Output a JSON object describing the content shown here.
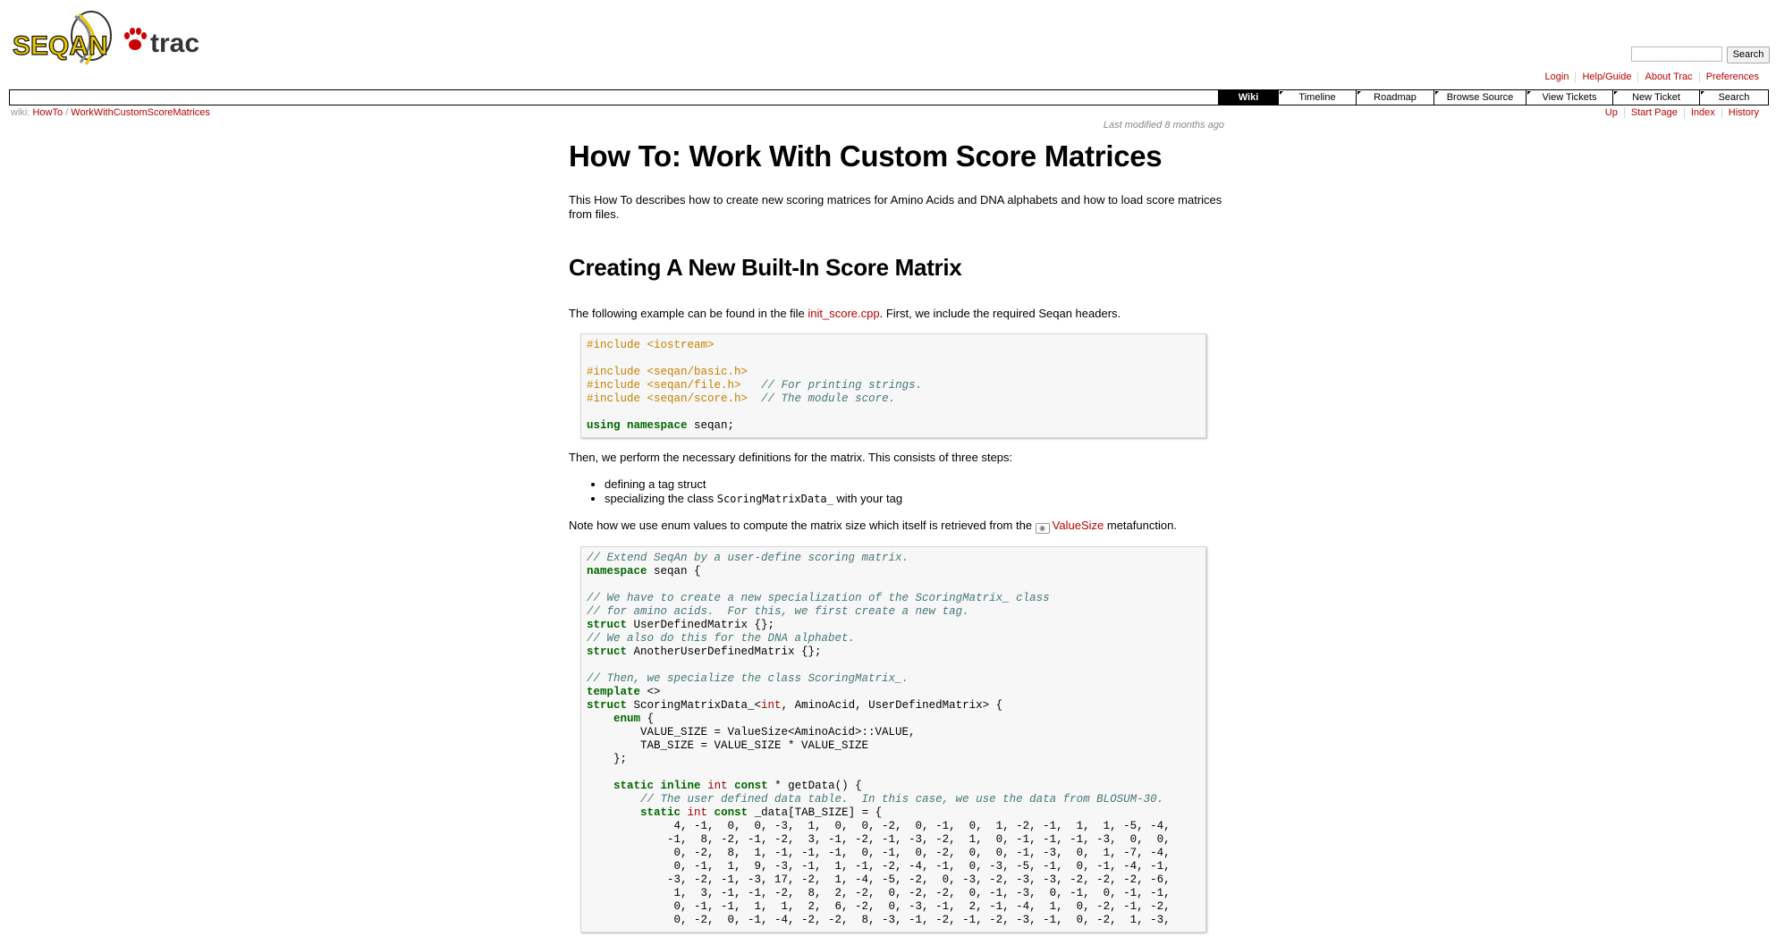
{
  "header": {
    "logo_text": "SEQAN",
    "logo_suffix": "trac",
    "search_button": "Search",
    "metanav": [
      "Login",
      "Help/Guide",
      "About Trac",
      "Preferences"
    ]
  },
  "mainnav": [
    {
      "label": "Wiki",
      "active": true
    },
    {
      "label": "Timeline",
      "active": false
    },
    {
      "label": "Roadmap",
      "active": false
    },
    {
      "label": "Browse Source",
      "active": false
    },
    {
      "label": "View Tickets",
      "active": false
    },
    {
      "label": "New Ticket",
      "active": false
    },
    {
      "label": "Search",
      "active": false
    }
  ],
  "breadcrumb": {
    "prefix": "wiki:",
    "items": [
      "HowTo",
      "WorkWithCustomScoreMatrices"
    ],
    "separator": "/"
  },
  "ctxtnav": [
    "Up",
    "Start Page",
    "Index",
    "History"
  ],
  "page": {
    "last_modified": "Last modified 8 months ago",
    "title": "How To: Work With Custom Score Matrices",
    "intro": "This How To describes how to create new scoring matrices for Amino Acids and DNA alphabets and how to load score matrices from files.",
    "section1_title": "Creating A New Built-In Score Matrix",
    "example_pre": "The following example can be found in the file ",
    "example_link": "init_score.cpp",
    "example_post": ". First, we include the required Seqan headers.",
    "defs_text": "Then, we perform the necessary definitions for the matrix. This consists of three steps:",
    "steps": [
      {
        "text": "defining a tag struct",
        "code": "",
        "post": ""
      },
      {
        "text": "specializing the class ",
        "code": "ScoringMatrixData_",
        "post": " with your tag"
      }
    ],
    "note_pre": "Note how we use enum values to compute the matrix size which itself is retrieved from the ",
    "note_link": "ValueSize",
    "note_post": " metafunction."
  },
  "code_block_1": [
    [
      [
        "pp",
        "#include <iostream>"
      ]
    ],
    [],
    [
      [
        "pp",
        "#include <seqan/basic.h>"
      ]
    ],
    [
      [
        "pp",
        "#include <seqan/file.h>"
      ],
      [
        "",
        "   "
      ],
      [
        "cm",
        "// For printing strings."
      ]
    ],
    [
      [
        "pp",
        "#include <seqan/score.h>"
      ],
      [
        "",
        "  "
      ],
      [
        "cm",
        "// The module score."
      ]
    ],
    [],
    [
      [
        "kw",
        "using namespace"
      ],
      [
        "",
        " seqan;"
      ]
    ]
  ],
  "code_block_2": [
    [
      [
        "cm",
        "// Extend SeqAn by a user-define scoring matrix."
      ]
    ],
    [
      [
        "kw",
        "namespace"
      ],
      [
        "",
        " seqan {"
      ]
    ],
    [],
    [
      [
        "cm",
        "// We have to create a new specialization of the ScoringMatrix_ class"
      ]
    ],
    [
      [
        "cm",
        "// for amino acids.  For this, we first create a new tag."
      ]
    ],
    [
      [
        "kw",
        "struct"
      ],
      [
        "",
        " UserDefinedMatrix {};"
      ]
    ],
    [
      [
        "cm",
        "// We also do this for the DNA alphabet."
      ]
    ],
    [
      [
        "kw",
        "struct"
      ],
      [
        "",
        " AnotherUserDefinedMatrix {};"
      ]
    ],
    [],
    [
      [
        "cm",
        "// Then, we specialize the class ScoringMatrix_."
      ]
    ],
    [
      [
        "kw",
        "template"
      ],
      [
        "",
        " <>"
      ]
    ],
    [
      [
        "kw",
        "struct"
      ],
      [
        "",
        " ScoringMatrixData_<"
      ],
      [
        "ty",
        "int"
      ],
      [
        "",
        ", AminoAcid, UserDefinedMatrix> {"
      ]
    ],
    [
      [
        "",
        "    "
      ],
      [
        "kw",
        "enum"
      ],
      [
        "",
        " {"
      ]
    ],
    [
      [
        "",
        "        VALUE_SIZE = ValueSize<AminoAcid>::VALUE,"
      ]
    ],
    [
      [
        "",
        "        TAB_SIZE = VALUE_SIZE * VALUE_SIZE"
      ]
    ],
    [
      [
        "",
        "    };"
      ]
    ],
    [],
    [
      [
        "",
        "    "
      ],
      [
        "kw",
        "static inline"
      ],
      [
        "",
        " "
      ],
      [
        "ty",
        "int"
      ],
      [
        "",
        " "
      ],
      [
        "kw",
        "const"
      ],
      [
        "",
        " * getData() {"
      ]
    ],
    [
      [
        "",
        "        "
      ],
      [
        "cm",
        "// The user defined data table.  In this case, we use the data from BLOSUM-30."
      ]
    ],
    [
      [
        "",
        "        "
      ],
      [
        "kw",
        "static"
      ],
      [
        "",
        " "
      ],
      [
        "ty",
        "int"
      ],
      [
        "",
        " "
      ],
      [
        "kw",
        "const"
      ],
      [
        "",
        " _data[TAB_SIZE] = {"
      ]
    ],
    [
      [
        "",
        "             4, -1,  0,  0, -3,  1,  0,  0, -2,  0, -1,  0,  1, -2, -1,  1,  1, -5, -4,"
      ]
    ],
    [
      [
        "",
        "            -1,  8, -2, -1, -2,  3, -1, -2, -1, -3, -2,  1,  0, -1, -1, -1, -3,  0,  0,"
      ]
    ],
    [
      [
        "",
        "             0, -2,  8,  1, -1, -1, -1,  0, -1,  0, -2,  0,  0, -1, -3,  0,  1, -7, -4,"
      ]
    ],
    [
      [
        "",
        "             0, -1,  1,  9, -3, -1,  1, -1, -2, -4, -1,  0, -3, -5, -1,  0, -1, -4, -1,"
      ]
    ],
    [
      [
        "",
        "            -3, -2, -1, -3, 17, -2,  1, -4, -5, -2,  0, -3, -2, -3, -3, -2, -2, -2, -6,"
      ]
    ],
    [
      [
        "",
        "             1,  3, -1, -1, -2,  8,  2, -2,  0, -2, -2,  0, -1, -3,  0, -1,  0, -1, -1,"
      ]
    ],
    [
      [
        "",
        "             0, -1, -1,  1,  1,  2,  6, -2,  0, -3, -1,  2, -1, -4,  1,  0, -2, -1, -2,"
      ]
    ],
    [
      [
        "",
        "             0, -2,  0, -1, -4, -2, -2,  8, -3, -1, -2, -1, -2, -3, -1,  0, -2,  1, -3,"
      ]
    ]
  ]
}
